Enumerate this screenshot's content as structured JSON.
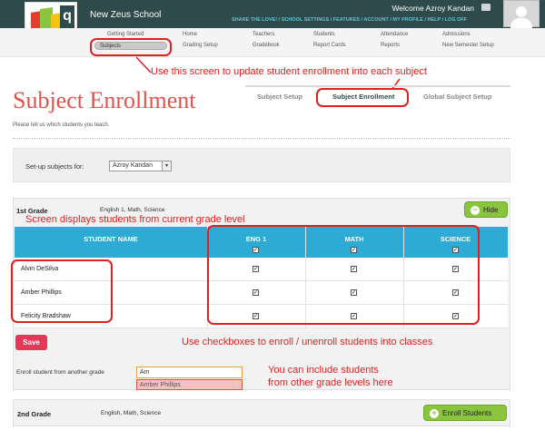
{
  "header": {
    "school_name": "New Zeus School",
    "welcome": "Welcome Azroy Kandan",
    "links": "SHARE THE LOVE! / SCHOOL SETTINGS / FEATURES / ACCOUNT / MY PROFILE / HELP / LOG OFF"
  },
  "nav": {
    "items": [
      {
        "top": "Getting Started",
        "bottom": "Subjects"
      },
      {
        "top": "Home",
        "bottom": "Grading Setup"
      },
      {
        "top": "Teachers",
        "bottom": "Gradebook"
      },
      {
        "top": "Students",
        "bottom": "Report Cards"
      },
      {
        "top": "Attendance",
        "bottom": "Reports"
      },
      {
        "top": "Admissions",
        "bottom": "New Semester Setup"
      }
    ]
  },
  "annotations": {
    "update": "Use this screen to update student enrollment into each subject",
    "grade_level": "Screen displays students from current grade level",
    "checkboxes": "Use checkboxes to enroll / unenroll students into classes",
    "include_1": "You can include students",
    "include_2": "from other grade levels here"
  },
  "page": {
    "title": "Subject Enrollment",
    "subtitle": "Please tell us which students you teach.",
    "tabs": [
      "Subject Setup",
      "Subject Enrollment",
      "Global Subject Setup"
    ],
    "active_tab": "Subject Enrollment"
  },
  "setup": {
    "label": "Set-up subjects for:",
    "selected": "Azroy Kandan"
  },
  "grade1": {
    "name": "1st Grade",
    "subjects": "English 1, Math, Science",
    "hide_label": "Hide",
    "columns": [
      "STUDENT NAME",
      "ENG 1",
      "MATH",
      "SCIENCE"
    ],
    "students": [
      {
        "name": "Alvin DeSilva",
        "checks": [
          true,
          true,
          true
        ]
      },
      {
        "name": "Amber Phillips",
        "checks": [
          true,
          true,
          true
        ]
      },
      {
        "name": "Felicity Bradshaw",
        "checks": [
          true,
          true,
          true
        ]
      }
    ],
    "save_label": "Save",
    "enroll_label": "Enroll student from another grade",
    "enroll_value": "Am",
    "suggestion": "Amber Phillips"
  },
  "grade2": {
    "name": "2nd Grade",
    "subjects": "English, Math, Science",
    "enroll_button": "Enroll Students"
  },
  "colors": {
    "topbar": "#2f4a4a",
    "accent_red": "#e02020",
    "title": "#e0534d",
    "table_header": "#2eabd4",
    "green_button": "#8bc53f",
    "save_button": "#e53859"
  }
}
